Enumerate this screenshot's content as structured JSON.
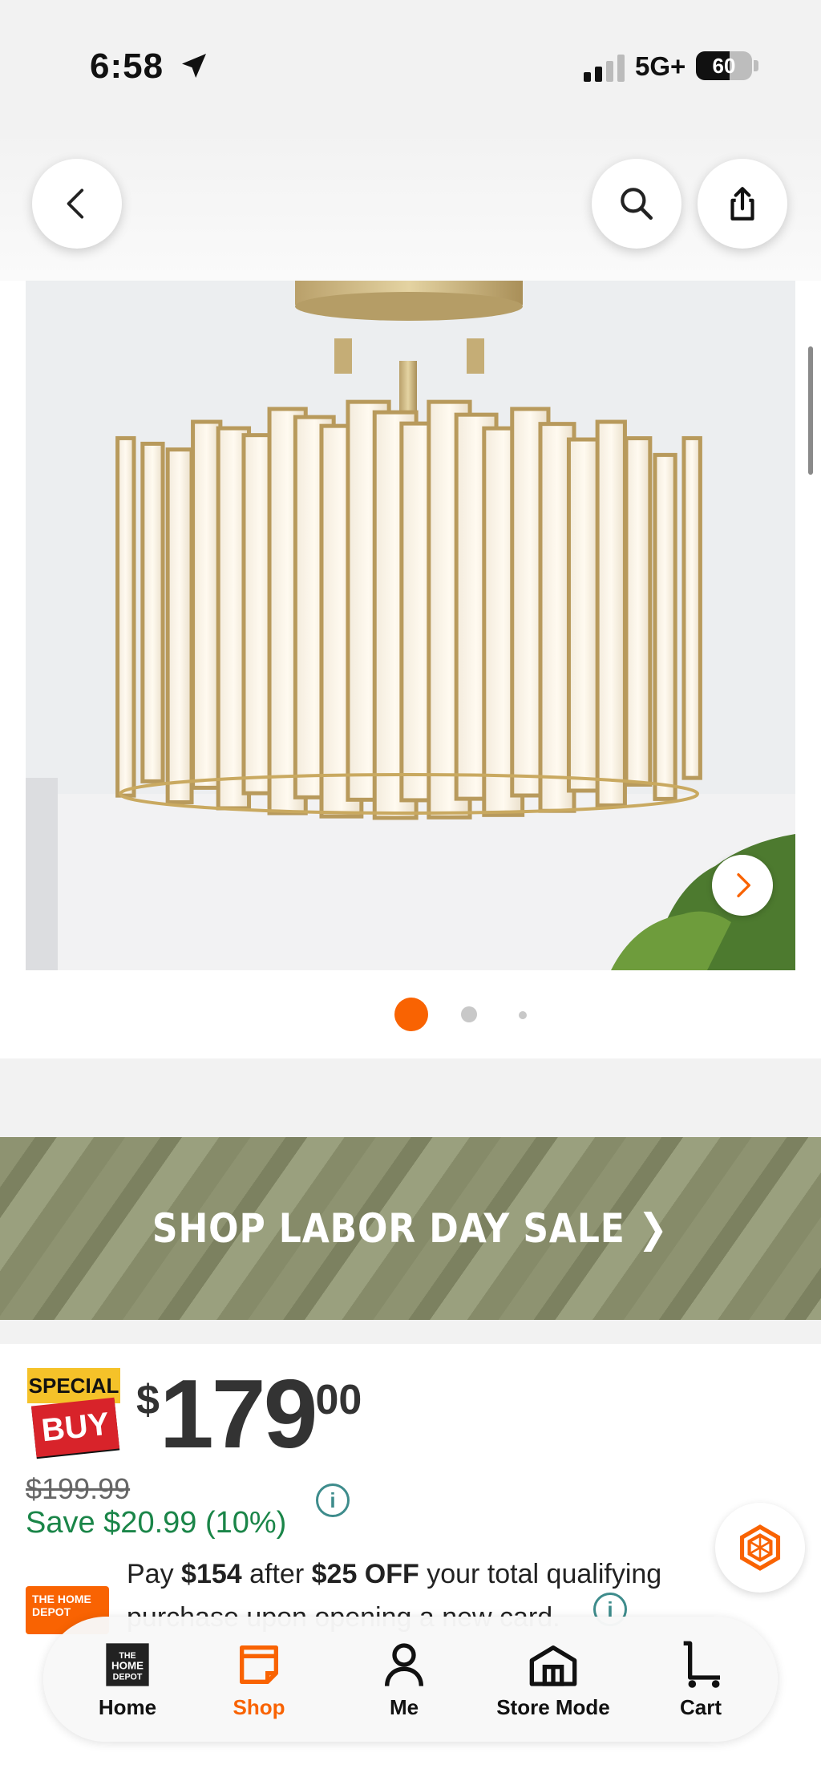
{
  "status_bar": {
    "time": "6:58",
    "network": "5G+",
    "battery": "60",
    "battery_level": 0.6
  },
  "product": {
    "image_alt": "Gold drum ceiling light with glass panels",
    "image_count": 3,
    "active_image": 0
  },
  "promo_banner": {
    "text": "SHOP LABOR DAY SALE ❯"
  },
  "pricing": {
    "badge_top": "SPECIAL",
    "badge_bottom": "BUY",
    "currency": "$",
    "price_dollars": "179",
    "price_cents": "00",
    "was_price": "$199.99",
    "savings": "Save $20.99 (10%)",
    "financing": {
      "p1": "Pay ",
      "amount": "$154",
      "p2": " after ",
      "discount": "$25 OFF",
      "p3": " your total qualifying purchase upon opening a new card."
    },
    "card_brand": "THE HOME DEPOT"
  },
  "tabs": [
    {
      "label": "Home",
      "icon": "home-depot-logo-icon"
    },
    {
      "label": "Shop",
      "icon": "shop-tag-icon"
    },
    {
      "label": "Me",
      "icon": "person-icon"
    },
    {
      "label": "Store Mode",
      "icon": "store-icon"
    },
    {
      "label": "Cart",
      "icon": "cart-icon"
    }
  ],
  "active_tab": "Shop",
  "colors": {
    "accent": "#f96302",
    "savings": "#1a8548",
    "special_yellow": "#f5c229",
    "buy_red": "#d8232a",
    "promo_green": "#8e9371"
  }
}
